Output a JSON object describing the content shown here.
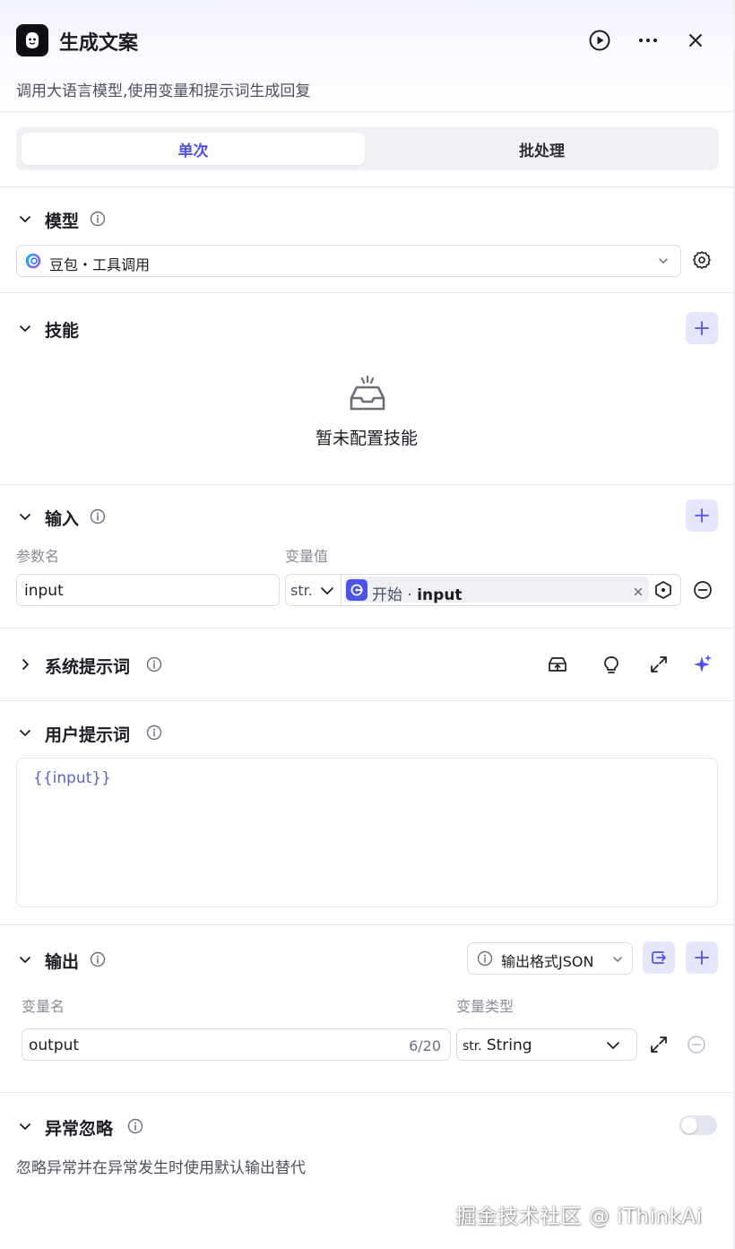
{
  "header": {
    "title": "生成文案",
    "subtitle": "调用大语言模型,使用变量和提示词生成回复"
  },
  "tabs": [
    {
      "label": "单次",
      "active": true
    },
    {
      "label": "批处理",
      "active": false
    }
  ],
  "model": {
    "title": "模型",
    "selected": "豆包・工具调用"
  },
  "skills": {
    "title": "技能",
    "empty_text": "暂未配置技能"
  },
  "input": {
    "title": "输入",
    "col_param": "参数名",
    "col_value": "变量值",
    "rows": [
      {
        "name": "input",
        "type": "str.",
        "source_node": "开始",
        "source_sep": "·",
        "source_var": "input"
      }
    ]
  },
  "system_prompt": {
    "title": "系统提示词"
  },
  "user_prompt": {
    "title": "用户提示词",
    "content": "{{input}}"
  },
  "output": {
    "title": "输出",
    "format_button": "输出格式JSON",
    "col_name": "变量名",
    "col_type": "变量类型",
    "rows": [
      {
        "name": "output",
        "counter": "6/20",
        "type_prefix": "str.",
        "type": "String"
      }
    ]
  },
  "exception": {
    "title": "异常忽略",
    "description": "忽略异常并在异常发生时使用默认输出替代",
    "enabled": false
  },
  "watermark": "掘金技术社区 @ iThinkAi",
  "colors": {
    "accent": "#4d53e8",
    "accent_bg": "#e5e6fb",
    "border": "#d9dbe3"
  }
}
